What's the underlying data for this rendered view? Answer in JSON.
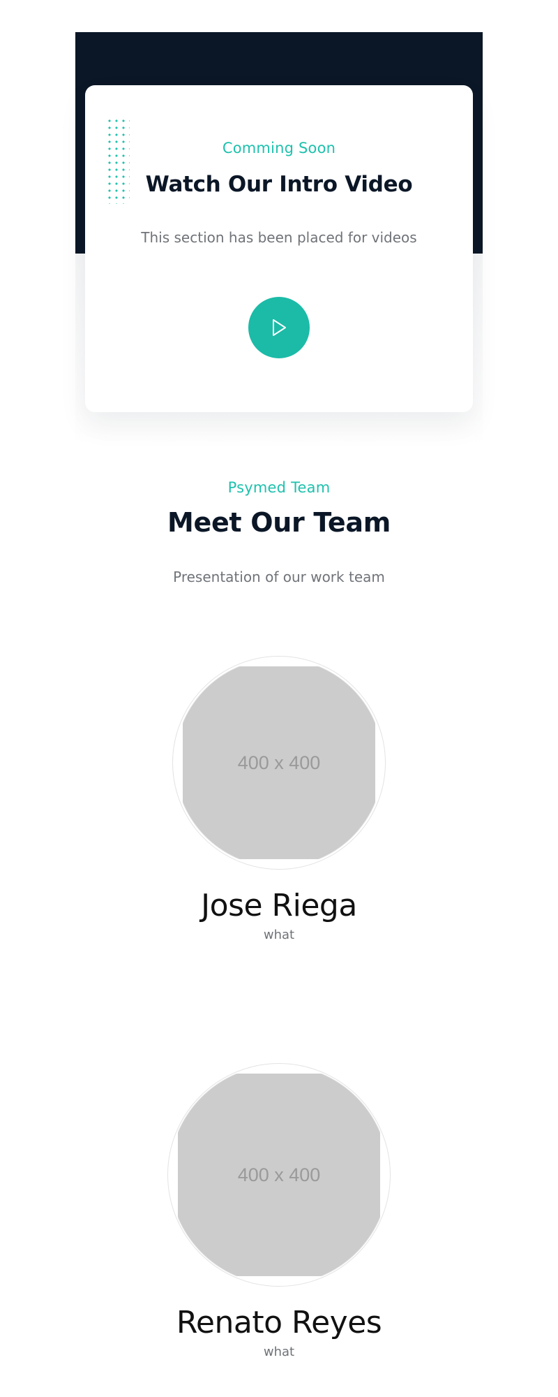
{
  "video_section": {
    "eyebrow": "Comming Soon",
    "title": "Watch Our Intro Video",
    "description": "This section has been placed for videos",
    "play_icon": "play-icon"
  },
  "team_section": {
    "eyebrow": "Psymed Team",
    "title": "Meet Our Team",
    "description": "Presentation of our work team",
    "members": [
      {
        "name": "Jose Riega",
        "role": "what",
        "photo_placeholder": "400 x 400"
      },
      {
        "name": "Renato Reyes",
        "role": "what",
        "photo_placeholder": "400 x 400"
      }
    ]
  },
  "colors": {
    "accent": "#1bbba7",
    "dark": "#0b1727",
    "muted_text": "#6f7378",
    "placeholder": "#cccccc"
  }
}
